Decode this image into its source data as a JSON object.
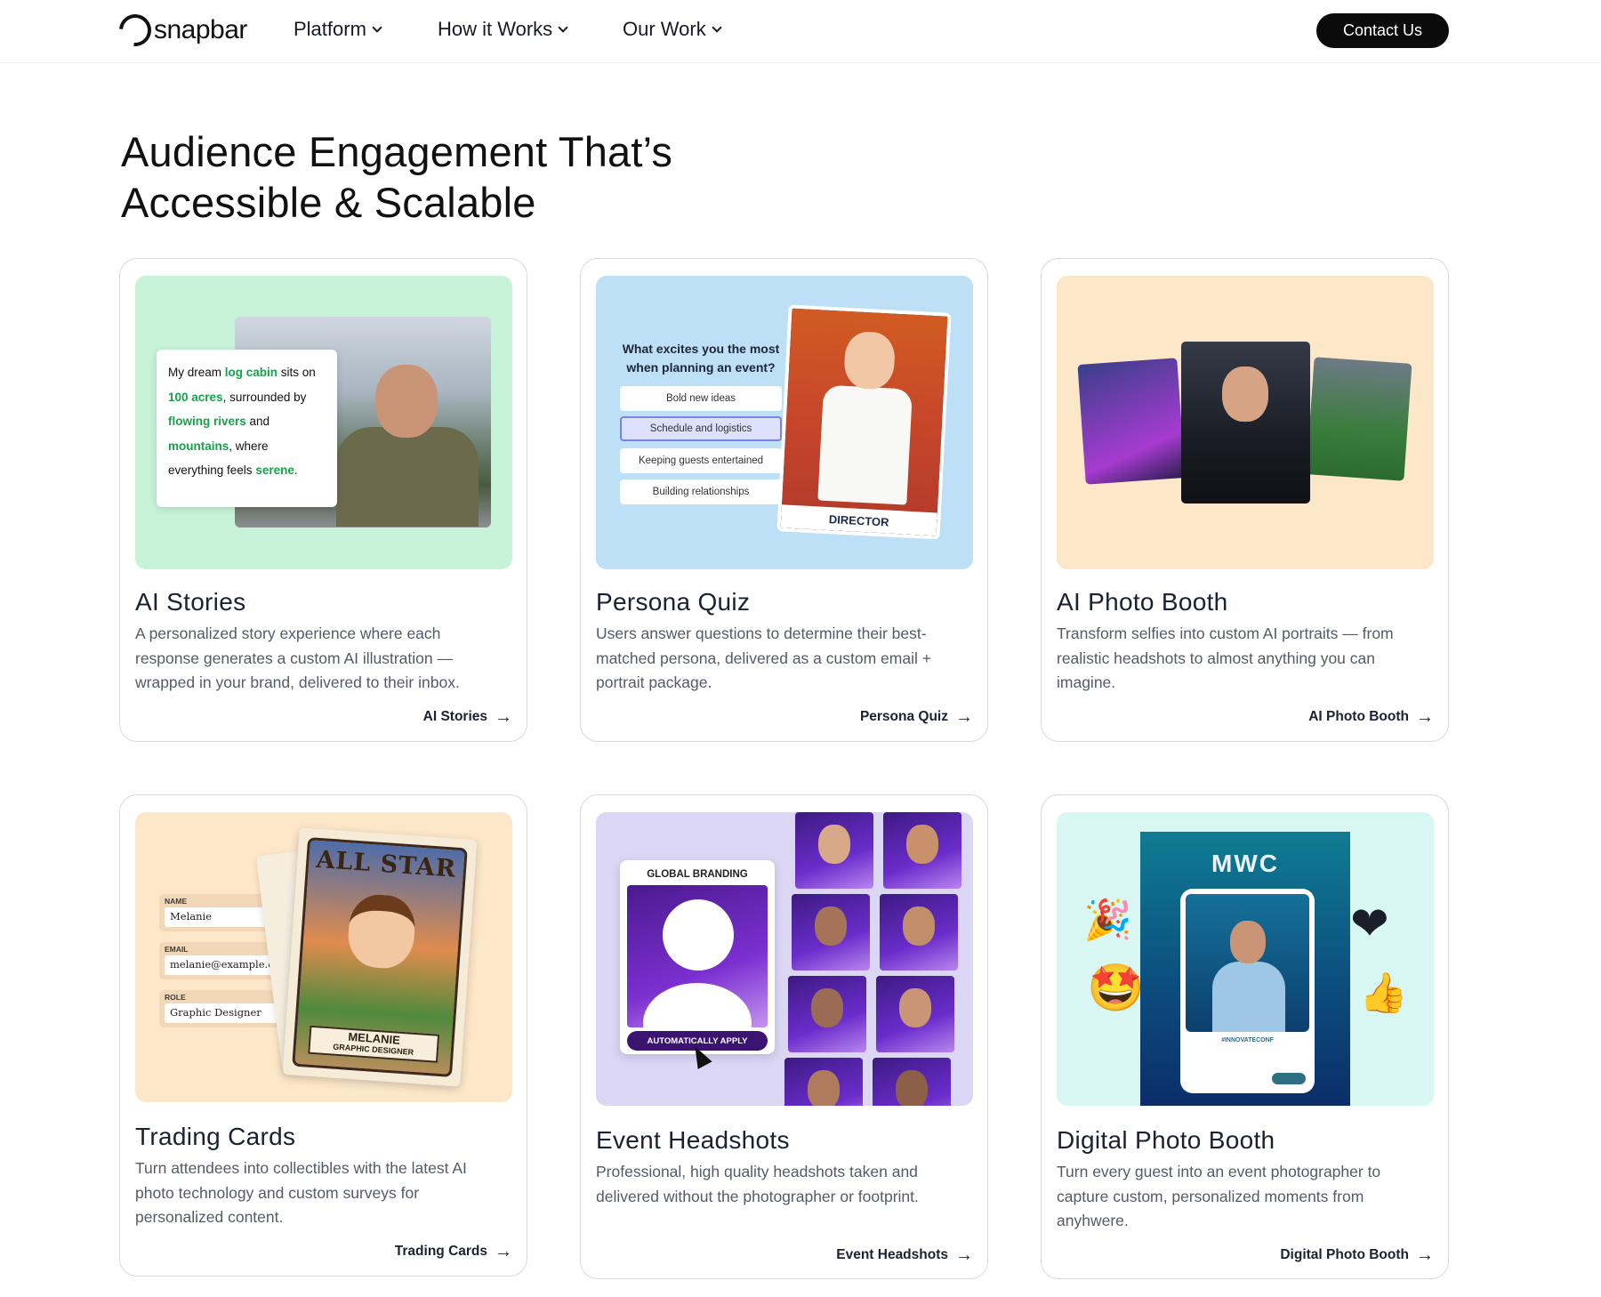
{
  "nav": {
    "logo_text": "snapbar",
    "items": [
      {
        "label": "Platform"
      },
      {
        "label": "How it Works"
      },
      {
        "label": "Our Work"
      }
    ],
    "contact_label": "Contact Us"
  },
  "heading": {
    "line1": "Audience Engagement That’s",
    "line2": "Accessible & Scalable"
  },
  "cards": [
    {
      "title": "AI Stories",
      "description": "A personalized story experience where each response generates a custom AI illustration — wrapped in your brand, delivered to their inbox.",
      "link": "AI Stories",
      "media": {
        "story": {
          "t1": "My dream ",
          "h1": "log cabin",
          "t2": " sits on",
          "h2": "100 acres",
          "t3": ", surrounded by",
          "h3": "flowing rivers",
          "t4": " and",
          "h4": "mountains",
          "t5": ", where",
          "t6": "everything feels ",
          "h5": "serene",
          "t7": "."
        }
      }
    },
    {
      "title": "Persona Quiz",
      "description": "Users answer questions to determine their best-matched persona, delivered as a custom email + portrait package.",
      "link": "Persona Quiz",
      "media": {
        "question": "What excites you the most when planning an event?",
        "options": [
          "Bold new ideas",
          "Schedule and logistics",
          "Keeping guests entertained",
          "Building relationships"
        ],
        "selected_option": "Schedule and logistics",
        "persona_label": "DIRECTOR"
      }
    },
    {
      "title": "AI Photo Booth",
      "description": "Transform selfies into custom AI portraits — from realistic headshots to almost anything you can imagine.",
      "link": "AI Photo Booth"
    },
    {
      "title": "Trading Cards",
      "description": "Turn attendees into collectibles with the latest AI photo technology and custom surveys for personalized content.",
      "link": "Trading Cards",
      "media": {
        "fields": [
          {
            "label": "NAME",
            "value": "Melanie"
          },
          {
            "label": "EMAIL",
            "value": "melanie@example.c"
          },
          {
            "label": "ROLE",
            "value": "Graphic Designer"
          }
        ],
        "card_title": "ALL STAR",
        "card_name": "MELANIE",
        "card_role": "GRAPHIC DESIGNER"
      }
    },
    {
      "title": "Event Headshots",
      "description": "Professional, high quality headshots taken and delivered without the photographer or footprint.",
      "link": "Event Headshots",
      "media": {
        "panel_label": "GLOBAL BRANDING",
        "button_label": "AUTOMATICALLY APPLY"
      }
    },
    {
      "title": "Digital Photo Booth",
      "description": "Turn every guest into an event photographer to capture custom, personalized moments from anyhwere.",
      "link": "Digital Photo Booth",
      "media": {
        "brand": "MWC",
        "hashtag": "#INNOVATECONF"
      }
    }
  ],
  "icons": {
    "chevron": "chevron-down-icon",
    "arrow": "arrow-right-icon",
    "arrow_glyph": "→"
  },
  "colors": {
    "ai_stories_bg": "#c7f3d8",
    "persona_bg": "#bde0f6",
    "photo_booth_bg": "#fde7c9",
    "trading_bg": "#fde7c9",
    "headshots_bg": "#dcd6f5",
    "digital_bg": "#d9f7f2",
    "highlight_green": "#15a34a",
    "button_dark": "#0b0b0b"
  }
}
